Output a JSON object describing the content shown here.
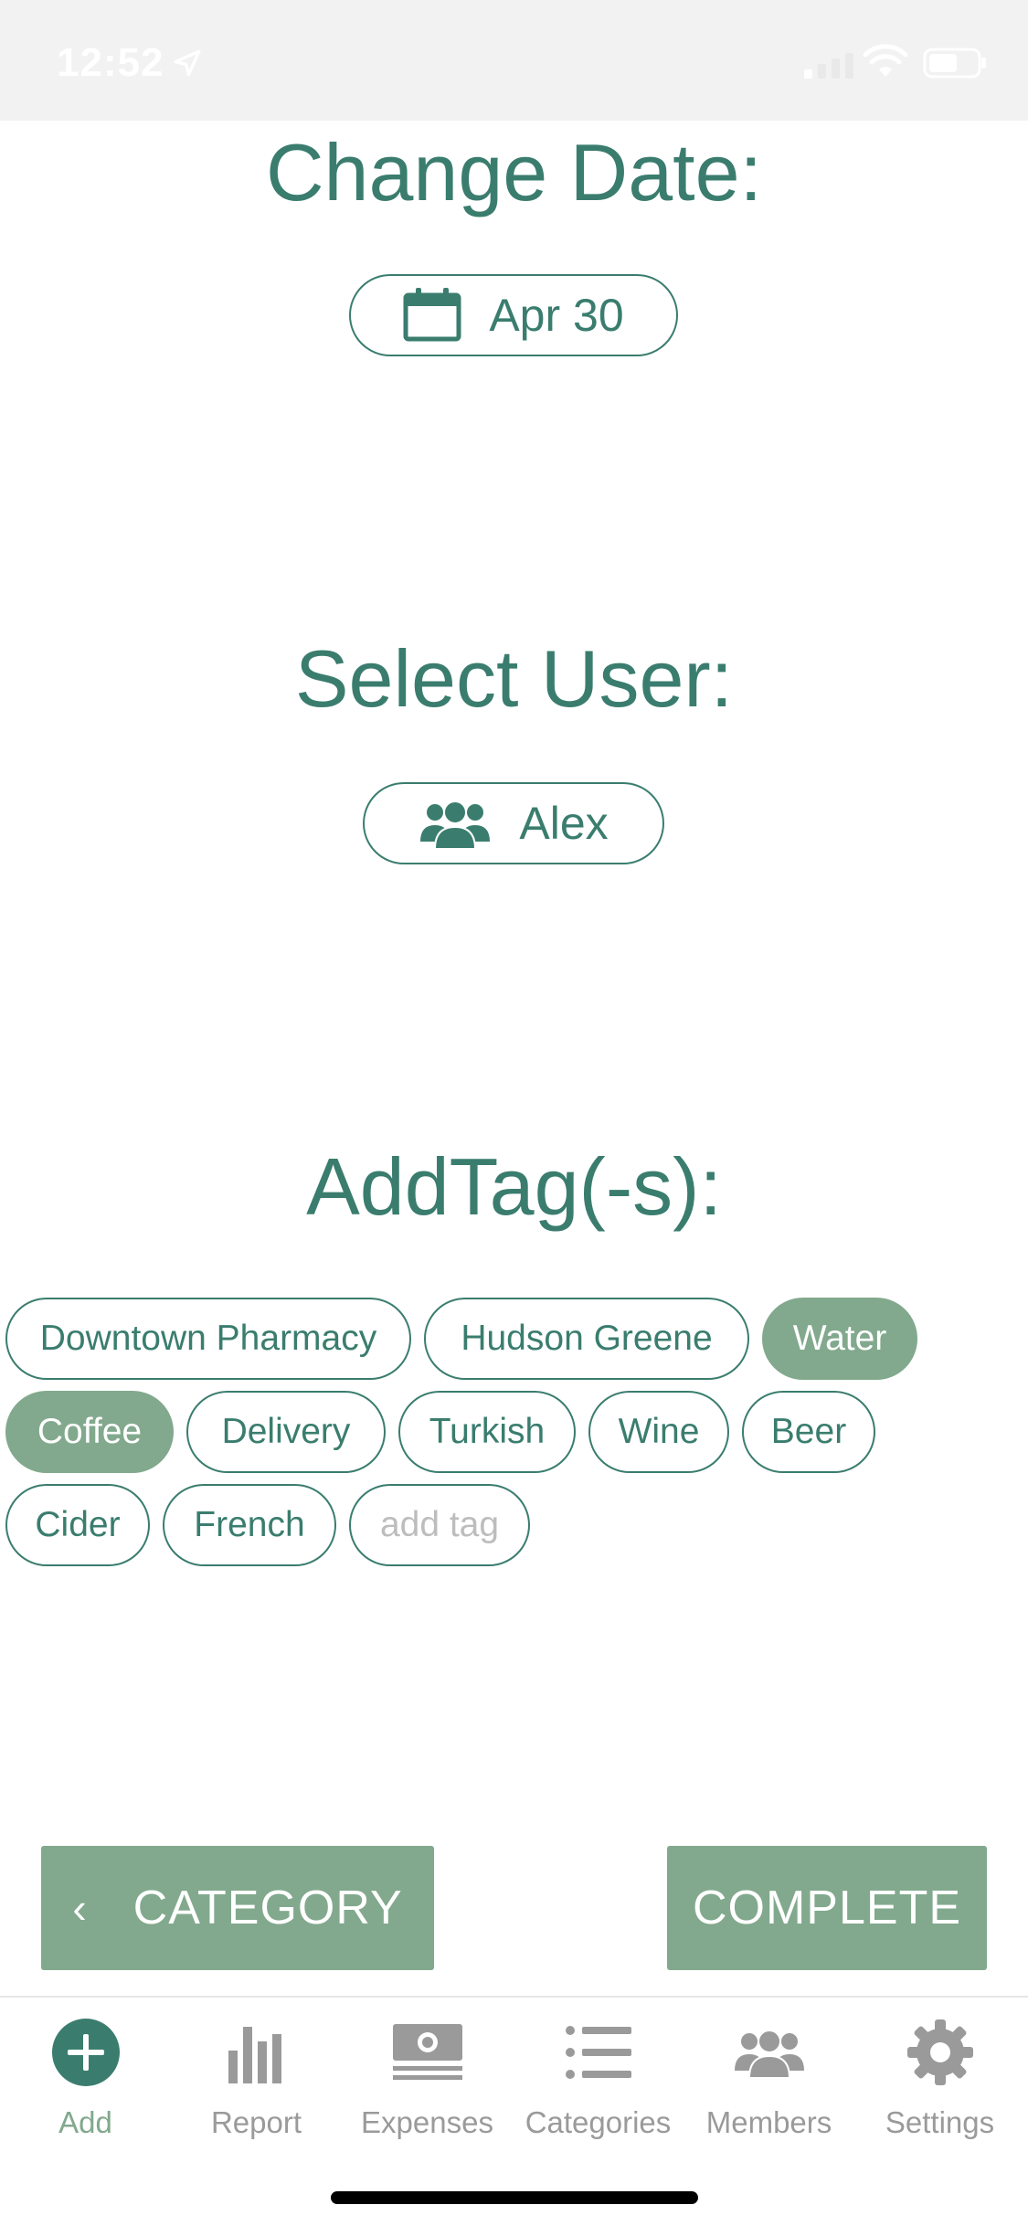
{
  "status_bar": {
    "time": "12:52"
  },
  "date_section": {
    "title": "Change Date:",
    "value": "Apr 30"
  },
  "user_section": {
    "title": "Select User:",
    "value": "Alex"
  },
  "tags_section": {
    "title": "AddTag(-s):",
    "tags": [
      {
        "label": "Downtown Pharmacy",
        "selected": false
      },
      {
        "label": "Hudson Greene",
        "selected": false
      },
      {
        "label": "Water",
        "selected": true
      },
      {
        "label": "Coffee",
        "selected": true
      },
      {
        "label": "Delivery",
        "selected": false
      },
      {
        "label": "Turkish",
        "selected": false
      },
      {
        "label": "Wine",
        "selected": false
      },
      {
        "label": "Beer",
        "selected": false
      },
      {
        "label": "Cider",
        "selected": false
      },
      {
        "label": "French",
        "selected": false
      }
    ],
    "add_placeholder": "add tag"
  },
  "actions": {
    "back_label": "CATEGORY",
    "complete_label": "COMPLETE"
  },
  "tab_bar": {
    "active": "Add",
    "items": [
      {
        "label": "Add",
        "icon": "add-icon"
      },
      {
        "label": "Report",
        "icon": "bar-chart-icon"
      },
      {
        "label": "Expenses",
        "icon": "money-icon"
      },
      {
        "label": "Categories",
        "icon": "list-icon"
      },
      {
        "label": "Members",
        "icon": "group-icon"
      },
      {
        "label": "Settings",
        "icon": "gear-icon"
      }
    ]
  },
  "colors": {
    "primary": "#3a7d6e",
    "accent": "#82a98d",
    "inactive": "#9a9a9a"
  }
}
